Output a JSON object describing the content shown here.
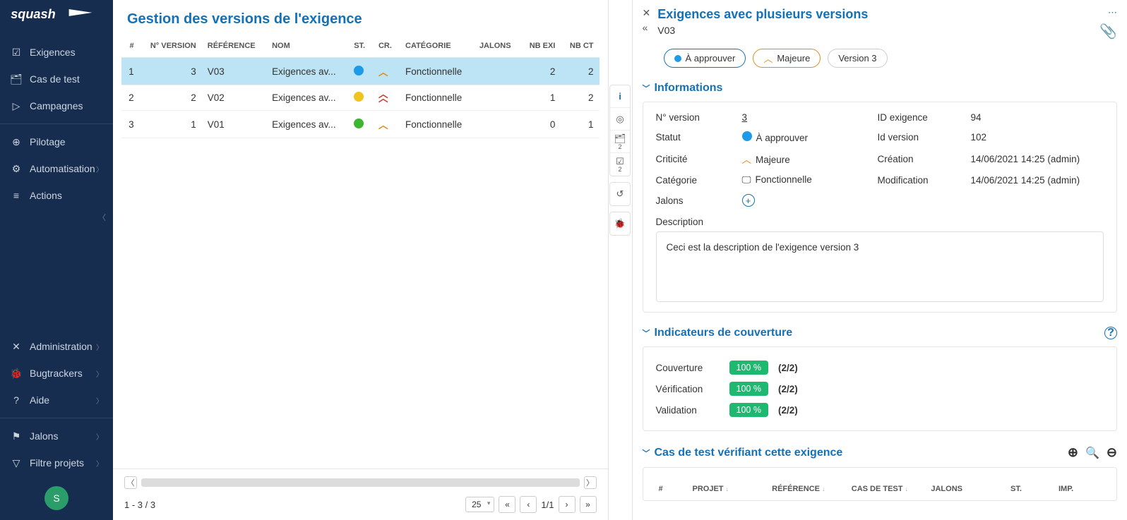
{
  "sidebar": {
    "logo_text": "squash",
    "items": [
      {
        "label": "Exigences",
        "icon": "check-square-icon",
        "chevron": false
      },
      {
        "label": "Cas de test",
        "icon": "tree-icon",
        "chevron": false
      },
      {
        "label": "Campagnes",
        "icon": "play-circle-icon",
        "chevron": false
      }
    ],
    "items2": [
      {
        "label": "Pilotage",
        "icon": "dashboard-icon",
        "chevron": false
      },
      {
        "label": "Automatisation",
        "icon": "cog-icon",
        "chevron": true
      },
      {
        "label": "Actions",
        "icon": "bars-icon",
        "chevron": false
      }
    ],
    "items3": [
      {
        "label": "Administration",
        "icon": "wrench-icon",
        "chevron": true
      },
      {
        "label": "Bugtrackers",
        "icon": "bug-icon",
        "chevron": true
      },
      {
        "label": "Aide",
        "icon": "help-icon",
        "chevron": true
      }
    ],
    "items4": [
      {
        "label": "Jalons",
        "icon": "flag-icon",
        "chevron": true
      },
      {
        "label": "Filtre projets",
        "icon": "filter-icon",
        "chevron": true
      }
    ],
    "avatar_letter": "S"
  },
  "main": {
    "title": "Gestion des versions de l'exigence",
    "columns": {
      "num": "#",
      "nversion": "N° VERSION",
      "reference": "RÉFÉRENCE",
      "nom": "NOM",
      "st": "ST.",
      "cr": "CR.",
      "categorie": "CATÉGORIE",
      "jalons": "JALONS",
      "nbexi": "NB EXI",
      "nbct": "NB CT"
    },
    "rows": [
      {
        "num": "1",
        "nversion": "3",
        "reference": "V03",
        "nom": "Exigences av...",
        "st_color": "#1e9be8",
        "cr_type": "single",
        "cr_color": "#e08a1c",
        "categorie": "Fonctionnelle",
        "jalons": "",
        "nbexi": "2",
        "nbct": "2",
        "selected": true
      },
      {
        "num": "2",
        "nversion": "2",
        "reference": "V02",
        "nom": "Exigences av...",
        "st_color": "#f0c41c",
        "cr_type": "double",
        "cr_color": "#c83a2a",
        "categorie": "Fonctionnelle",
        "jalons": "",
        "nbexi": "1",
        "nbct": "2",
        "selected": false
      },
      {
        "num": "3",
        "nversion": "1",
        "reference": "V01",
        "nom": "Exigences av...",
        "st_color": "#3db52e",
        "cr_type": "single",
        "cr_color": "#e08a1c",
        "categorie": "Fonctionnelle",
        "jalons": "",
        "nbexi": "0",
        "nbct": "1",
        "selected": false
      }
    ],
    "footer": {
      "range": "1 - 3 / 3",
      "page_size": "25",
      "page": "1/1"
    }
  },
  "gutter": {
    "badge2a": "2",
    "badge2b": "2"
  },
  "details": {
    "title": "Exigences avec plusieurs versions",
    "version": "V03",
    "chips": {
      "status": "À approuver",
      "criticity": "Majeure",
      "ver": "Version 3"
    },
    "sections": {
      "info_title": "Informations",
      "coverage_title": "Indicateurs de couverture",
      "tests_title": "Cas de test vérifiant cette exigence"
    },
    "info": {
      "labels": {
        "nversion": "N° version",
        "statut": "Statut",
        "criticite": "Criticité",
        "categorie": "Catégorie",
        "jalons": "Jalons",
        "idexigence": "ID exigence",
        "idversion": "Id version",
        "creation": "Création",
        "modification": "Modification",
        "description": "Description"
      },
      "values": {
        "nversion": "3",
        "statut": "À approuver",
        "criticite": "Majeure",
        "categorie": "Fonctionnelle",
        "idexigence": "94",
        "idversion": "102",
        "creation": "14/06/2021 14:25 (admin)",
        "modification": "14/06/2021 14:25 (admin)",
        "description_text": "Ceci est la description de l'exigence version 3"
      }
    },
    "coverage": {
      "labels": {
        "couverture": "Couverture",
        "verification": "Vérification",
        "validation": "Validation"
      },
      "rows": [
        {
          "label": "Couverture",
          "badge": "100 %",
          "frac": "(2/2)"
        },
        {
          "label": "Vérification",
          "badge": "100 %",
          "frac": "(2/2)"
        },
        {
          "label": "Validation",
          "badge": "100 %",
          "frac": "(2/2)"
        }
      ]
    },
    "tests_columns": {
      "num": "#",
      "projet": "PROJET",
      "reference": "RÉFÉRENCE",
      "cas": "CAS DE TEST",
      "jalons": "JALONS",
      "st": "ST.",
      "imp": "IMP."
    }
  }
}
